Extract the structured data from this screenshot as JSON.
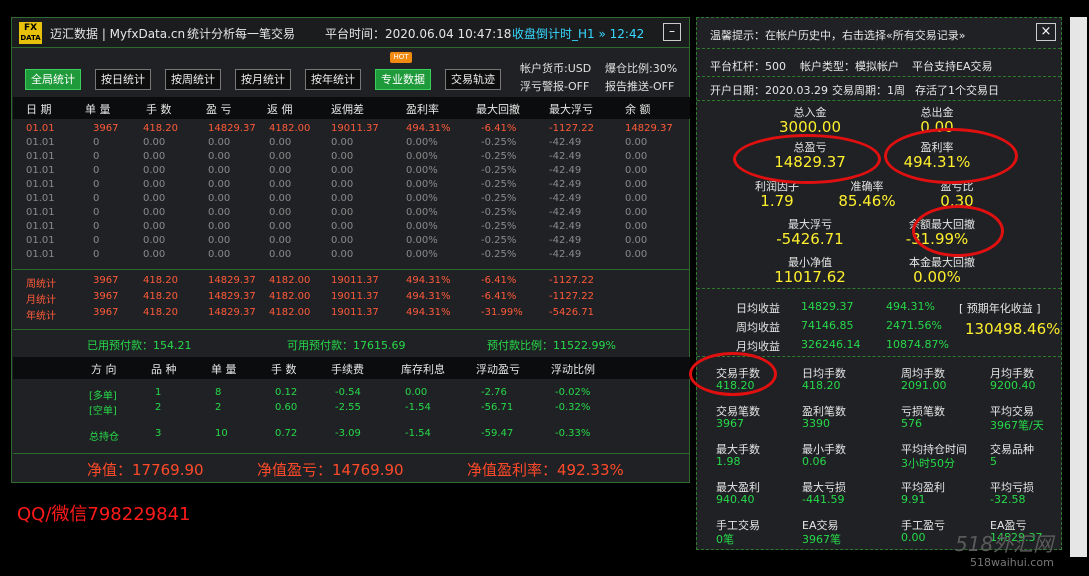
{
  "app": {
    "title": "迈汇数据 | MyfxData.cn",
    "subtitle": "统计分析每一笔交易",
    "platform_time": "平台时间：2020.06.04 10:47:18",
    "countdown": "收盘倒计时_H1 » 12:42",
    "minimize": "–",
    "logo_top": "FX",
    "logo_bottom": "DATA"
  },
  "tabs": [
    "全局统计",
    "按日统计",
    "按周统计",
    "按月统计",
    "按年统计",
    "专业数据",
    "交易轨迹"
  ],
  "hot_badge": "HOT",
  "options": {
    "currency": "帐户货币:USD",
    "margin": "爆仓比例:30%",
    "alert": "浮亏警报-OFF",
    "report": "报告推送-OFF"
  },
  "table": {
    "headers": [
      "日 期",
      "单 量",
      "手 数",
      "盈 亏",
      "返 佣",
      "返佣差",
      "盈利率",
      "最大回撤",
      "最大浮亏",
      "余 额"
    ],
    "rows": [
      [
        "01.01",
        "3967",
        "418.20",
        "14829.37",
        "4182.00",
        "19011.37",
        "494.31%",
        "-6.41%",
        "-1127.22",
        "14829.37"
      ],
      [
        "01.01",
        "0",
        "0.00",
        "0.00",
        "0.00",
        "0.00",
        "0.00%",
        "-0.25%",
        "-42.49",
        "0.00"
      ],
      [
        "01.01",
        "0",
        "0.00",
        "0.00",
        "0.00",
        "0.00",
        "0.00%",
        "-0.25%",
        "-42.49",
        "0.00"
      ],
      [
        "01.01",
        "0",
        "0.00",
        "0.00",
        "0.00",
        "0.00",
        "0.00%",
        "-0.25%",
        "-42.49",
        "0.00"
      ],
      [
        "01.01",
        "0",
        "0.00",
        "0.00",
        "0.00",
        "0.00",
        "0.00%",
        "-0.25%",
        "-42.49",
        "0.00"
      ],
      [
        "01.01",
        "0",
        "0.00",
        "0.00",
        "0.00",
        "0.00",
        "0.00%",
        "-0.25%",
        "-42.49",
        "0.00"
      ],
      [
        "01.01",
        "0",
        "0.00",
        "0.00",
        "0.00",
        "0.00",
        "0.00%",
        "-0.25%",
        "-42.49",
        "0.00"
      ],
      [
        "01.01",
        "0",
        "0.00",
        "0.00",
        "0.00",
        "0.00",
        "0.00%",
        "-0.25%",
        "-42.49",
        "0.00"
      ],
      [
        "01.01",
        "0",
        "0.00",
        "0.00",
        "0.00",
        "0.00",
        "0.00%",
        "-0.25%",
        "-42.49",
        "0.00"
      ],
      [
        "01.01",
        "0",
        "0.00",
        "0.00",
        "0.00",
        "0.00",
        "0.00%",
        "-0.25%",
        "-42.49",
        "0.00"
      ]
    ],
    "summary": [
      [
        "周统计",
        "3967",
        "418.20",
        "14829.37",
        "4182.00",
        "19011.37",
        "494.31%",
        "-6.41%",
        "-1127.22"
      ],
      [
        "月统计",
        "3967",
        "418.20",
        "14829.37",
        "4182.00",
        "19011.37",
        "494.31%",
        "-6.41%",
        "-1127.22"
      ],
      [
        "年统计",
        "3967",
        "418.20",
        "14829.37",
        "4182.00",
        "19011.37",
        "494.31%",
        "-31.99%",
        "-5426.71"
      ]
    ]
  },
  "deposits": {
    "used": "已用预付款：154.21",
    "available": "可用预付款：17615.69",
    "ratio": "预付款比例：11522.99%"
  },
  "positions": {
    "headers": [
      "方 向",
      "品 种",
      "单 量",
      "手 数",
      "手续费",
      "库存利息",
      "浮动盈亏",
      "浮动比例"
    ],
    "rows": [
      [
        "[多单]",
        "1",
        "8",
        "0.12",
        "-0.54",
        "0.00",
        "-2.76",
        "-0.02%"
      ],
      [
        "[空单]",
        "2",
        "2",
        "0.60",
        "-2.55",
        "-1.54",
        "-56.71",
        "-0.32%"
      ],
      [
        "总持仓",
        "3",
        "10",
        "0.72",
        "-3.09",
        "-1.54",
        "-59.47",
        "-0.33%"
      ]
    ]
  },
  "totals": {
    "equity": "净值：17769.90",
    "equity_pl": "净值盈亏：14769.90",
    "equity_rate": "净值盈利率：492.33%"
  },
  "contact": "QQ/微信798229841",
  "right": {
    "hint": "温馨提示：在帐户历史中，右击选择«所有交易记录»",
    "close": "×",
    "info1": [
      "平台杠杆：500",
      "帐户类型：模拟帐户",
      "平台支持EA交易"
    ],
    "info2": [
      "开户日期：2020.03.29",
      "交易周期：1周",
      "存活了1个交易日"
    ],
    "kpis": [
      {
        "label": "总入金",
        "value": "3000.00"
      },
      {
        "label": "总出金",
        "value": "0.00"
      },
      {
        "label": "总盈亏",
        "value": "14829.37"
      },
      {
        "label": "盈利率",
        "value": "494.31%"
      },
      {
        "label": "利润因子",
        "value": "1.79"
      },
      {
        "label": "准确率",
        "value": "85.46%"
      },
      {
        "label": "盈亏比",
        "value": "0.30"
      },
      {
        "label": "最大浮亏",
        "value": "-5426.71"
      },
      {
        "label": "余额最大回撤",
        "value": "-31.99%"
      },
      {
        "label": "最小净值",
        "value": "11017.62"
      },
      {
        "label": "本金最大回撤",
        "value": "0.00%"
      }
    ],
    "earnings": [
      {
        "label": "日均收益",
        "amount": "14829.37",
        "rate": "494.31%"
      },
      {
        "label": "周均收益",
        "amount": "74146.85",
        "rate": "2471.56%"
      },
      {
        "label": "月均收益",
        "amount": "326246.14",
        "rate": "10874.87%"
      }
    ],
    "annual_label": "[ 预期年化收益 ]",
    "annual_value": "130498.46%",
    "grid": [
      [
        {
          "l": "交易手数",
          "v": "418.20"
        },
        {
          "l": "日均手数",
          "v": "418.20"
        },
        {
          "l": "周均手数",
          "v": "2091.00"
        },
        {
          "l": "月均手数",
          "v": "9200.40"
        }
      ],
      [
        {
          "l": "交易笔数",
          "v": "3967"
        },
        {
          "l": "盈利笔数",
          "v": "3390"
        },
        {
          "l": "亏损笔数",
          "v": "576"
        },
        {
          "l": "平均交易",
          "v": "3967笔/天"
        }
      ],
      [
        {
          "l": "最大手数",
          "v": "1.98"
        },
        {
          "l": "最小手数",
          "v": "0.06"
        },
        {
          "l": "平均持仓时间",
          "v": "3小时50分"
        },
        {
          "l": "交易品种",
          "v": "5"
        }
      ],
      [
        {
          "l": "最大盈利",
          "v": "940.40"
        },
        {
          "l": "最大亏损",
          "v": "-441.59"
        },
        {
          "l": "平均盈利",
          "v": "9.91"
        },
        {
          "l": "平均亏损",
          "v": "-32.58"
        }
      ],
      [
        {
          "l": "手工交易",
          "v": "0笔"
        },
        {
          "l": "EA交易",
          "v": "3967笔"
        },
        {
          "l": "手工盈亏",
          "v": "0.00"
        },
        {
          "l": "EA盈亏",
          "v": "14829.37"
        }
      ]
    ]
  },
  "watermark": {
    "main": "518外汇网",
    "url": "518waihui.com"
  },
  "colors": {
    "accent_green": "#1f9a3a",
    "red": "#ff5a3a",
    "yellow": "#ffef2e",
    "cyan": "#37d7ff",
    "circle": "#e01010"
  }
}
